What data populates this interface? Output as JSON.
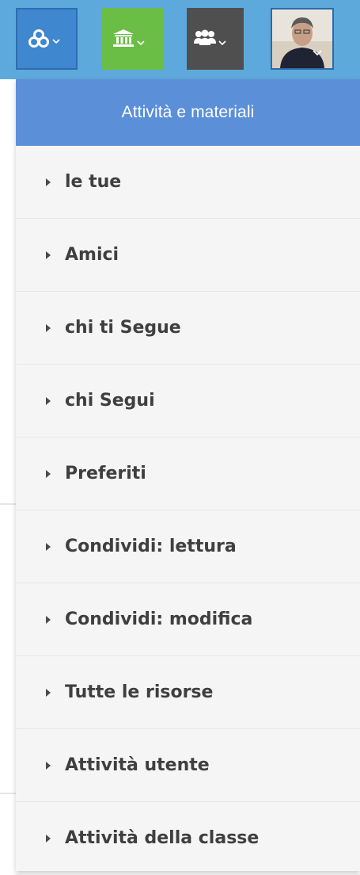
{
  "topbar": {
    "buttons": [
      {
        "icon": "apps-icon",
        "color": "#3f87cf"
      },
      {
        "icon": "school-icon",
        "color": "#6abd45"
      },
      {
        "icon": "groups-icon",
        "color": "#4f4f4f"
      },
      {
        "icon": "user-avatar",
        "color": "#e8e3da"
      }
    ],
    "bar_color": "#5ea9dc"
  },
  "dropdown": {
    "title": "Attività e materiali",
    "header_color": "#5b8fd8",
    "items": [
      {
        "label": "le tue"
      },
      {
        "label": "Amici"
      },
      {
        "label": "chi ti Segue"
      },
      {
        "label": "chi Segui"
      },
      {
        "label": "Preferiti"
      },
      {
        "label": "Condividi: lettura"
      },
      {
        "label": "Condividi: modifica"
      },
      {
        "label": "Tutte le risorse"
      },
      {
        "label": "Attività utente"
      },
      {
        "label": "Attività della classe"
      }
    ]
  }
}
